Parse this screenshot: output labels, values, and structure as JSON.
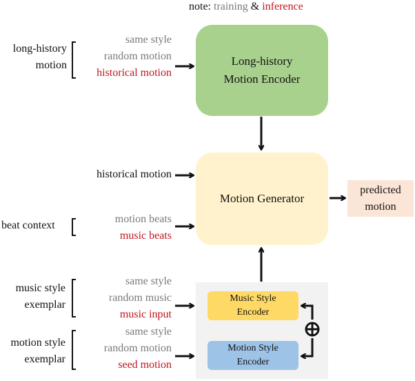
{
  "note": {
    "prefix": "note: ",
    "training": "training",
    "amp": " & ",
    "inference": "inference"
  },
  "colors": {
    "training": "#7a7a7a",
    "inference": "#c0141c",
    "lh_encoder": "#a9d18e",
    "generator": "#fff2cc",
    "predicted": "#fbe5d6",
    "music_encoder": "#ffd966",
    "motion_encoder": "#9dc3e6",
    "style_panel": "#f2f2f2"
  },
  "inputs": {
    "long_history": {
      "label_line1": "long-history",
      "label_line2": "motion",
      "options": [
        "same style",
        "random motion",
        "historical motion"
      ]
    },
    "historical_motion": {
      "label": "historical motion"
    },
    "beat_context": {
      "label": "beat context",
      "options": [
        "motion beats",
        "music beats"
      ]
    },
    "music_style": {
      "label_line1": "music style",
      "label_line2": "exemplar",
      "options": [
        "same style",
        "random music",
        "music input"
      ]
    },
    "motion_style": {
      "label_line1": "motion style",
      "label_line2": "exemplar",
      "options": [
        "same style",
        "random motion",
        "seed motion"
      ]
    }
  },
  "blocks": {
    "lh_encoder": {
      "line1": "Long-history",
      "line2": "Motion Encoder"
    },
    "generator": {
      "label": "Motion Generator"
    },
    "predicted": {
      "line1": "predicted",
      "line2": "motion"
    },
    "music_encoder": {
      "line1": "Music Style",
      "line2": "Encoder"
    },
    "motion_encoder": {
      "line1": "Motion Style",
      "line2": "Encoder"
    },
    "combine_symbol": "⊕"
  }
}
